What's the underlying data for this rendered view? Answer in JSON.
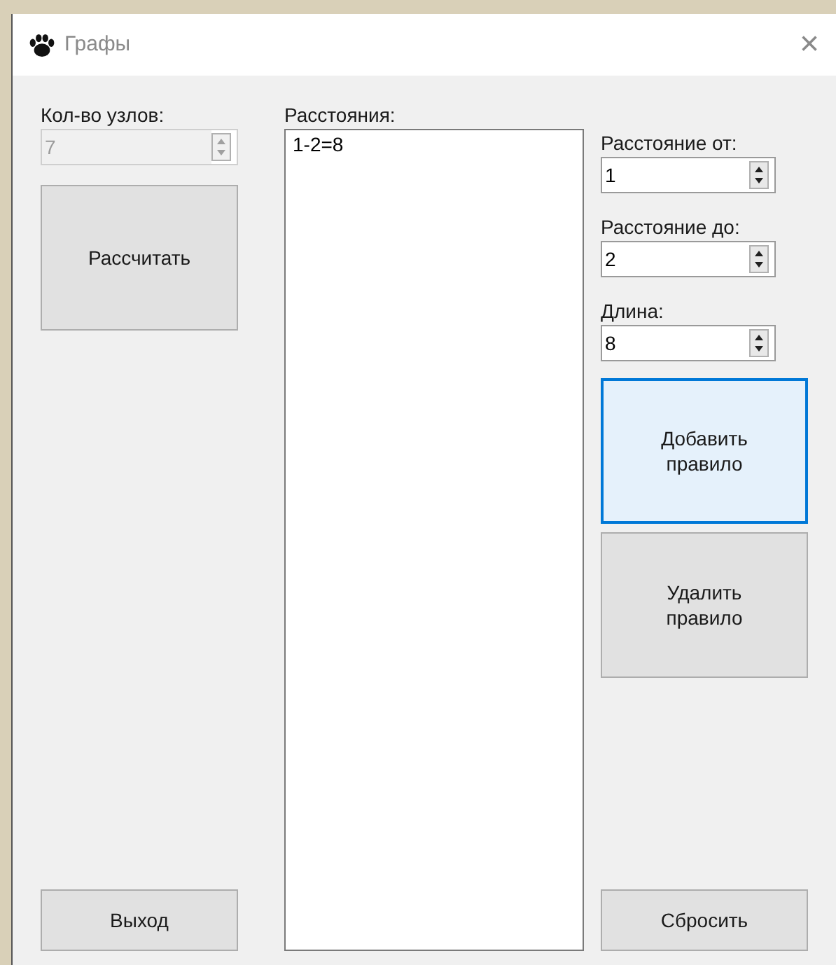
{
  "window": {
    "title": "Графы",
    "close": "×"
  },
  "nodes": {
    "label": "Кол-во узлов:",
    "value": "7",
    "disabled": true
  },
  "calculate_button": {
    "label": "Рассчитать",
    "highlighted": false
  },
  "exit_button": {
    "label": "Выход",
    "highlighted": false
  },
  "distances": {
    "label": "Расстояния:",
    "items": [
      {
        "text": "1-2=8",
        "selected": false
      }
    ]
  },
  "fields": [
    {
      "label": "Расстояние от:",
      "value": "1",
      "disabled": false
    },
    {
      "label": "Расстояние до:",
      "value": "2",
      "disabled": false
    },
    {
      "label": "Длина:",
      "value": "8",
      "disabled": false
    }
  ],
  "action_buttons": [
    {
      "label": "Добавить правило",
      "highlighted": true
    },
    {
      "label": "Удалить правило",
      "highlighted": false
    }
  ],
  "reset_button": {
    "label": "Сбросить",
    "highlighted": false
  }
}
